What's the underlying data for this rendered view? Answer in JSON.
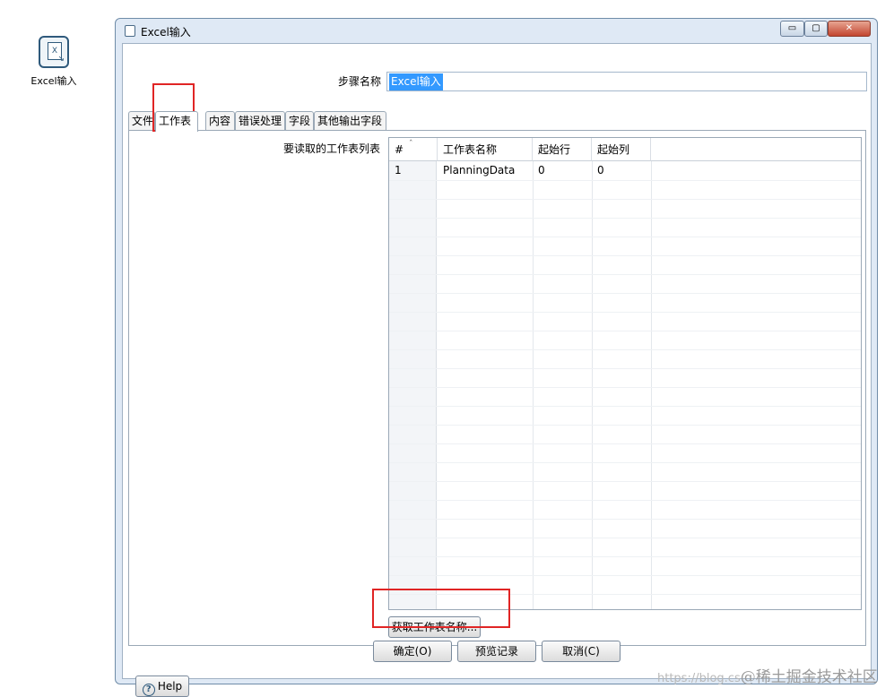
{
  "desktop": {
    "icon_label": "Excel输入",
    "icon_glyph": "X",
    "icon_arrow": "↘"
  },
  "window": {
    "title": "Excel输入",
    "controls": {
      "minimize": "▭",
      "maximize": "▢",
      "close": "✕"
    },
    "step_name_label": "步骤名称",
    "step_name_value": "Excel输入",
    "tabs": [
      {
        "label": "文件",
        "active": false
      },
      {
        "label": "工作表",
        "active": true
      },
      {
        "label": "内容",
        "active": false
      },
      {
        "label": "错误处理",
        "active": false
      },
      {
        "label": "字段",
        "active": false
      },
      {
        "label": "其他输出字段",
        "active": false
      }
    ],
    "sheet_list_label": "要读取的工作表列表",
    "table": {
      "headers": [
        "#",
        "工作表名称",
        "起始行",
        "起始列"
      ],
      "sort_caret": "ˆ",
      "rows": [
        [
          "1",
          "PlanningData",
          "0",
          "0"
        ]
      ]
    },
    "get_sheet_names_button": "获取工作表名称...",
    "buttons": {
      "ok": "确定(O)",
      "preview": "预览记录",
      "cancel": "取消(C)",
      "help": "Help",
      "help_icon": "?"
    }
  },
  "watermark": {
    "url_text": "https://blog.cs",
    "brand_text": "@稀土掘金技术社区"
  },
  "colors": {
    "selection": "#3399ff",
    "annotation_red": "#e02525",
    "window_frame": "#dfe9f5"
  }
}
